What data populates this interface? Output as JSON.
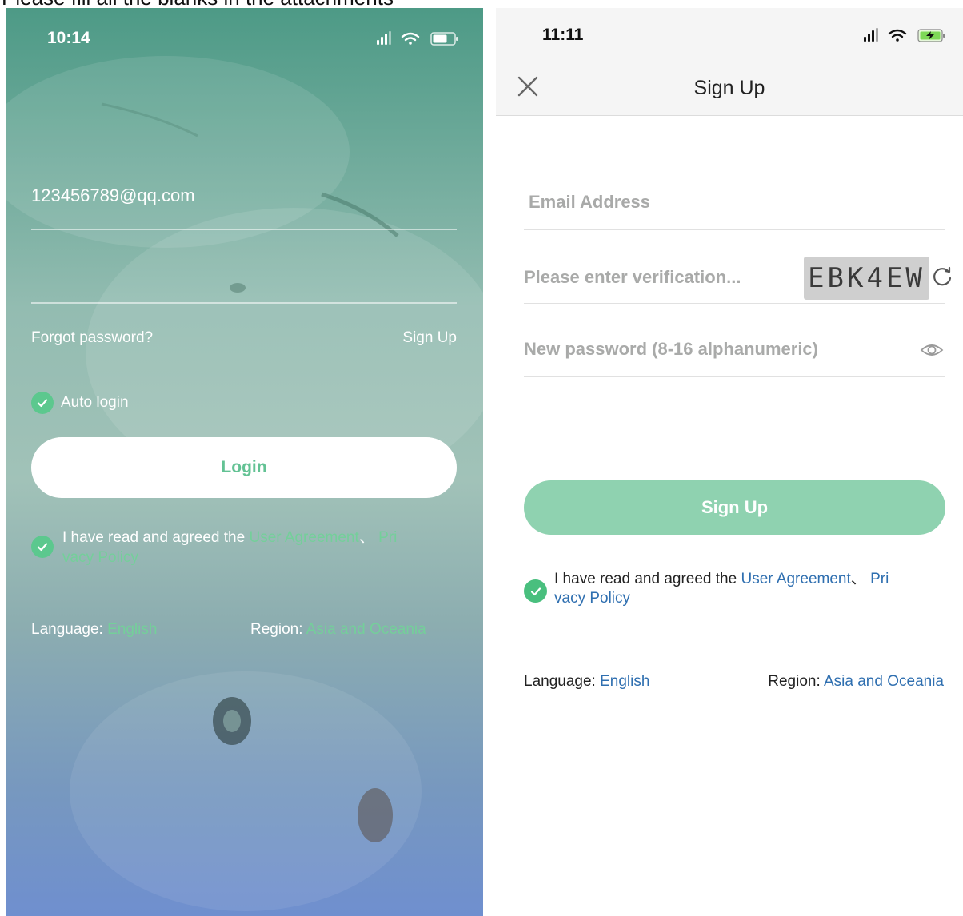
{
  "caption": {
    "text": "Please fill all the blanks in the attachments"
  },
  "login_screen": {
    "status_time": "10:14",
    "email_value": "123456789@qq.com",
    "forgot_label": "Forgot password?",
    "signup_link": "Sign Up",
    "auto_login_label": "Auto login",
    "login_button": "Login",
    "agree_prefix": "I have read and agreed the ",
    "user_agreement": "User Agreement",
    "separator": "、",
    "privacy_a": "Pri",
    "privacy_b": "vacy Policy",
    "language_label": "Language:",
    "language_value": "English",
    "region_label": "Region:",
    "region_value": "Asia and Oceania"
  },
  "signup_screen": {
    "status_time": "11:11",
    "title": "Sign Up",
    "email_placeholder": "Email Address",
    "verification_placeholder": "Please enter verification...",
    "captcha_text": "EBK4EW",
    "password_placeholder": "New password (8-16 alphanumeric)",
    "signup_button": "Sign Up",
    "agree_prefix": "I have read and agreed the ",
    "user_agreement": "User Agreement",
    "separator": "、",
    "privacy_a": "Pri",
    "privacy_b": "vacy Policy",
    "language_label": "Language:",
    "language_value": "English",
    "region_label": "Region:",
    "region_value": "Asia and Oceania"
  },
  "colors": {
    "accent_green": "#5cc88e",
    "signup_button": "#8fd2b0",
    "link_blue": "#2f6fb0"
  }
}
